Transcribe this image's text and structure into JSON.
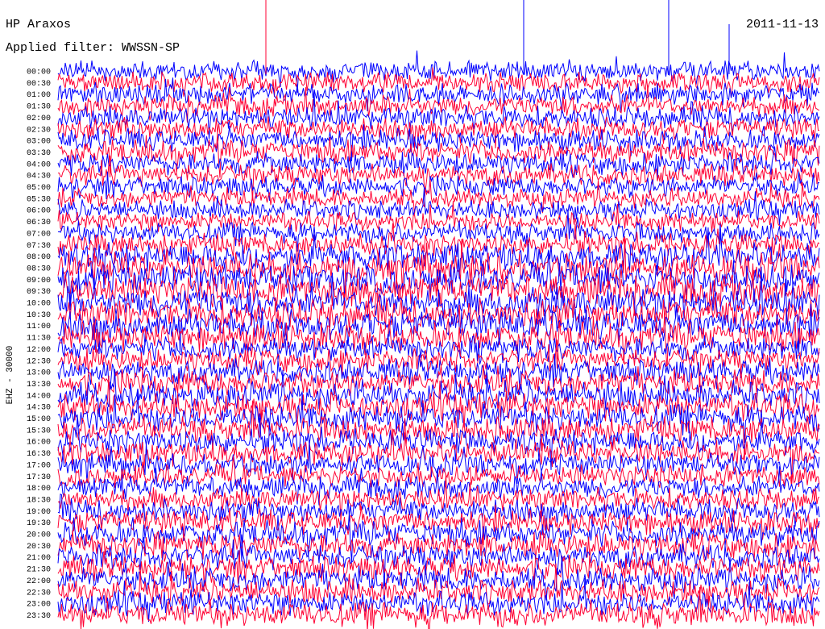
{
  "header": {
    "station": "HP Araxos",
    "date": "2011-11-13",
    "filter_label": "Applied filter: WWSSN-SP"
  },
  "chart_data": {
    "type": "helicorder",
    "channel_label": "EHZ - 30000",
    "row_labels": [
      "00:00",
      "00:30",
      "01:00",
      "01:30",
      "02:00",
      "02:30",
      "03:00",
      "03:30",
      "04:00",
      "04:30",
      "05:00",
      "05:30",
      "06:00",
      "06:30",
      "07:00",
      "07:30",
      "08:00",
      "08:30",
      "09:00",
      "09:30",
      "10:00",
      "10:30",
      "11:00",
      "11:30",
      "12:00",
      "12:30",
      "13:00",
      "13:30",
      "14:00",
      "14:30",
      "15:00",
      "15:30",
      "16:00",
      "16:30",
      "17:00",
      "17:30",
      "18:00",
      "18:30",
      "19:00",
      "19:30",
      "20:00",
      "20:30",
      "21:00",
      "21:30",
      "22:00",
      "22:30",
      "23:00",
      "23:30"
    ],
    "trace_colors": [
      "#0000ff",
      "#ff0033"
    ],
    "relative_noise_level": [
      0.5,
      0.5,
      0.55,
      0.55,
      0.6,
      0.6,
      0.6,
      0.65,
      0.6,
      0.6,
      0.55,
      0.5,
      0.5,
      0.5,
      0.55,
      0.6,
      0.9,
      0.95,
      1.0,
      1.0,
      1.0,
      0.95,
      0.95,
      0.9,
      0.7,
      0.65,
      0.75,
      0.8,
      0.85,
      0.85,
      0.85,
      0.8,
      0.75,
      0.7,
      0.6,
      0.6,
      0.6,
      0.6,
      0.65,
      0.7,
      0.75,
      0.75,
      0.75,
      0.75,
      0.75,
      0.75,
      0.7,
      0.75
    ]
  }
}
